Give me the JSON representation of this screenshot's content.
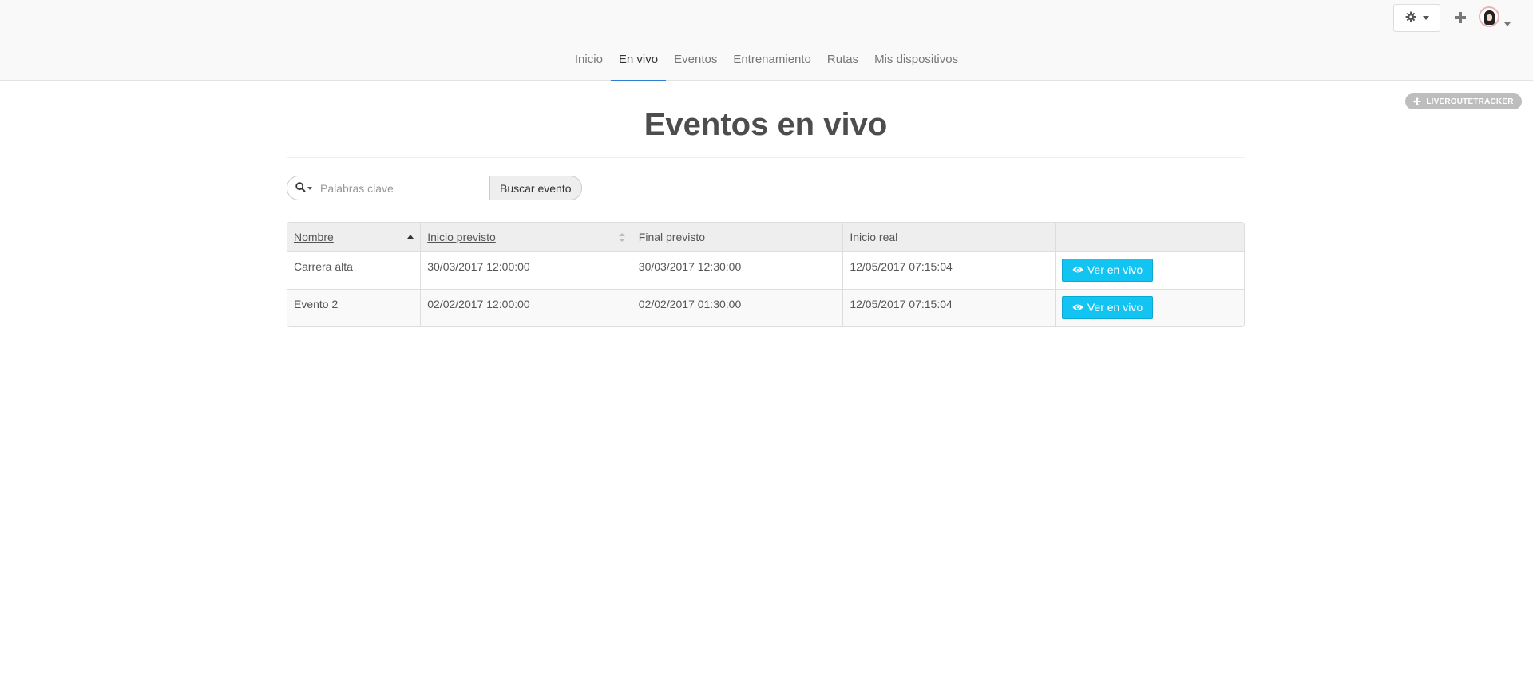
{
  "nav": {
    "items": [
      {
        "label": "Inicio",
        "active": false
      },
      {
        "label": "En vivo",
        "active": true
      },
      {
        "label": "Eventos",
        "active": false
      },
      {
        "label": "Entrenamiento",
        "active": false
      },
      {
        "label": "Rutas",
        "active": false
      },
      {
        "label": "Mis dispositivos",
        "active": false
      }
    ]
  },
  "header": {
    "settings_icon": "gear-icon",
    "add_icon": "plus-icon",
    "badge_label": "LIVEROUTETRACKER"
  },
  "page": {
    "title": "Eventos en vivo"
  },
  "search": {
    "placeholder": "Palabras clave",
    "value": "",
    "button_label": "Buscar evento"
  },
  "table": {
    "columns": [
      {
        "label": "Nombre",
        "sortable": true,
        "sort": "asc"
      },
      {
        "label": "Inicio previsto",
        "sortable": true,
        "sort": "none"
      },
      {
        "label": "Final previsto",
        "sortable": false
      },
      {
        "label": "Inicio real",
        "sortable": false
      },
      {
        "label": "",
        "sortable": false
      }
    ],
    "rows": [
      {
        "nombre": "Carrera alta",
        "inicio_previsto": "30/03/2017 12:00:00",
        "final_previsto": "30/03/2017 12:30:00",
        "inicio_real": "12/05/2017 07:15:04",
        "action": "Ver en vivo"
      },
      {
        "nombre": "Evento 2",
        "inicio_previsto": "02/02/2017 12:00:00",
        "final_previsto": "02/02/2017 01:30:00",
        "inicio_real": "12/05/2017 07:15:04",
        "action": "Ver en vivo"
      }
    ]
  },
  "colors": {
    "accent": "#2a7fd4",
    "live_button": "#12c4f2"
  }
}
